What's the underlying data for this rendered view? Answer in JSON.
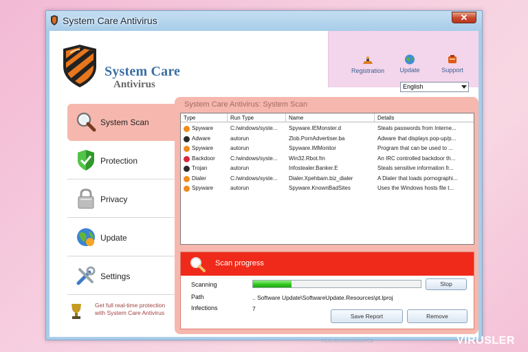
{
  "window": {
    "title": "System Care Antivirus",
    "close_label": "✕"
  },
  "logo": {
    "title": "System Care",
    "subtitle": "Antivirus"
  },
  "toolbar": {
    "registration": "Registration",
    "update": "Update",
    "support": "Support",
    "language": "English"
  },
  "sidebar": {
    "items": [
      {
        "label": "System Scan",
        "icon": "magnifier-icon",
        "active": true
      },
      {
        "label": "Protection",
        "icon": "shield-check-icon",
        "active": false
      },
      {
        "label": "Privacy",
        "icon": "padlock-icon",
        "active": false
      },
      {
        "label": "Update",
        "icon": "globe-icon",
        "active": false
      },
      {
        "label": "Settings",
        "icon": "tools-icon",
        "active": false
      }
    ],
    "promo_text": "Get full real-time protection with System Care Antivirus"
  },
  "panel": {
    "title": "System Care Antivirus: System Scan"
  },
  "table": {
    "headers": [
      "Type",
      "Run Type",
      "Name",
      "Details"
    ],
    "rows": [
      {
        "type": "Spyware",
        "run_type": "C:/windows/syste...",
        "name": "Spyware.IEMonster.d",
        "details": "Steals passwords from Interne...",
        "color": "#f08a1c"
      },
      {
        "type": "Adware",
        "run_type": "autorun",
        "name": "Zlob.PornAdvertiser.ba",
        "details": "Adware that displays pop-up/p...",
        "color": "#2a2a2a"
      },
      {
        "type": "Spyware",
        "run_type": "autorun",
        "name": "Spyware.IMMonitor",
        "details": "Program that can be used to ...",
        "color": "#f08a1c"
      },
      {
        "type": "Backdoor",
        "run_type": "C:/windows/syste...",
        "name": "Win32.Rbot.fm",
        "details": "An IRC controlled backdoor th...",
        "color": "#d8283a"
      },
      {
        "type": "Trojan",
        "run_type": "autorun",
        "name": "Infostealer.Banker.E",
        "details": "Steals sensitive information fr...",
        "color": "#2a2a2a"
      },
      {
        "type": "Dialer",
        "run_type": "C:/windows/syste...",
        "name": "Dialer.Xpehbam.biz_dialer",
        "details": "A Dialer that loads pornographi...",
        "color": "#f08a1c"
      },
      {
        "type": "Spyware",
        "run_type": "autorun",
        "name": "Spyware.KnownBadSites",
        "details": "Uses the Windows hosts file t...",
        "color": "#f08a1c"
      }
    ]
  },
  "scan": {
    "header": "Scan progress",
    "scanning_label": "Scanning",
    "progress_fraction": 0.23,
    "stop_label": "Stop",
    "path_label": "Path",
    "path_value": ".. Software Update\\SoftwareUpdate.Resources\\pt.lproj",
    "infections_label": "Infections",
    "infections_value": "7",
    "save_report_label": "Save Report",
    "remove_label": "Remove"
  },
  "footer": {
    "pid": "PCID:361991016A2FCB",
    "watermark": "VIRUSLER"
  },
  "colors": {
    "accent_red": "#f02a1a",
    "panel_pink": "#f6b8ae",
    "window_blue": "#a9cde9",
    "progress_green": "#2ec51c"
  }
}
